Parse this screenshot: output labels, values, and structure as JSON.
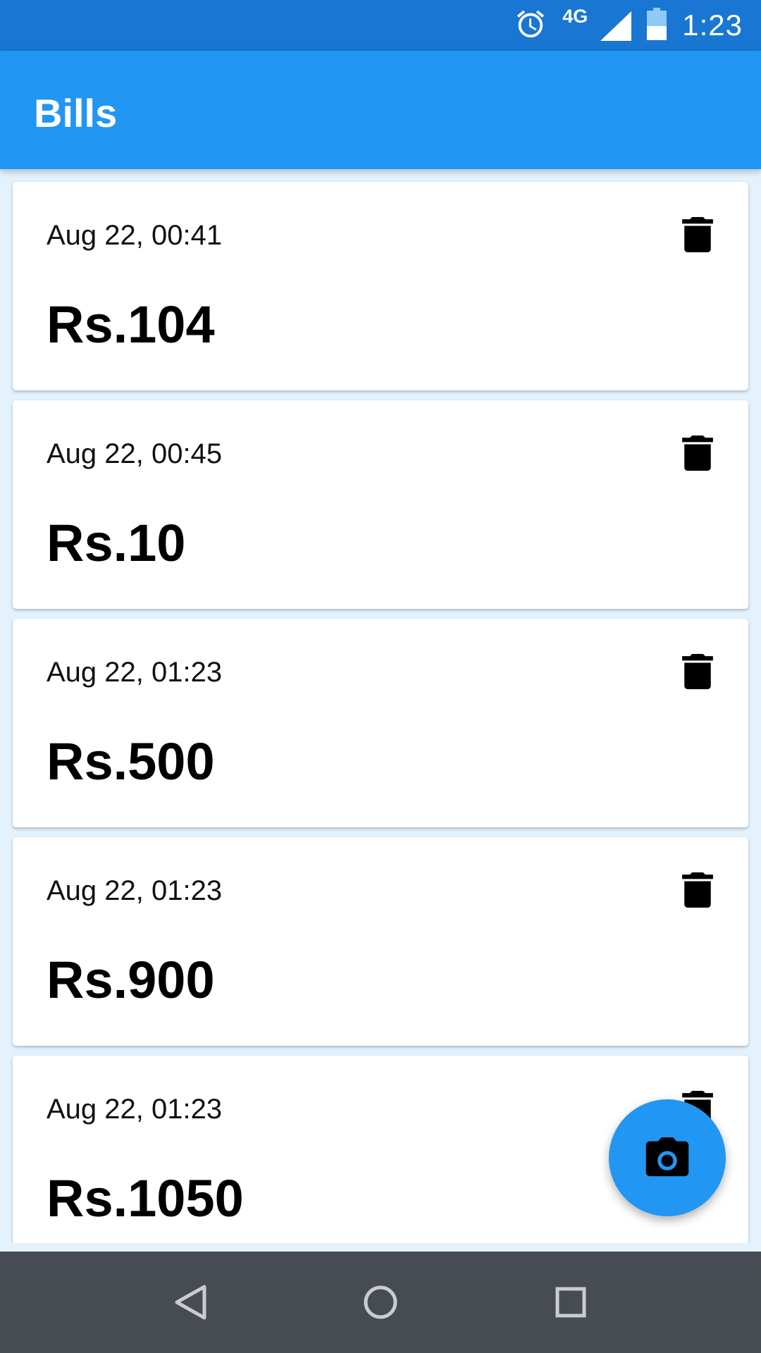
{
  "status_bar": {
    "network_label": "4G",
    "time": "1:23"
  },
  "app_bar": {
    "title": "Bills"
  },
  "bills": [
    {
      "date": "Aug 22, 00:41",
      "amount": "Rs.104"
    },
    {
      "date": "Aug 22, 00:45",
      "amount": "Rs.10"
    },
    {
      "date": "Aug 22, 01:23",
      "amount": "Rs.500"
    },
    {
      "date": "Aug 22, 01:23",
      "amount": "Rs.900"
    },
    {
      "date": "Aug 22, 01:23",
      "amount": "Rs.1050"
    }
  ],
  "icons": {
    "status": [
      "alarm-icon",
      "signal-icon",
      "battery-icon"
    ],
    "card_action": "delete-icon",
    "fab": "camera-icon",
    "nav": [
      "back-icon",
      "home-icon",
      "recents-icon"
    ]
  },
  "colors": {
    "status_bar": "#1976D2",
    "app_bar": "#2196F3",
    "background": "#E3F2FD",
    "nav_bar": "#474C53",
    "fab": "#2196F3"
  }
}
